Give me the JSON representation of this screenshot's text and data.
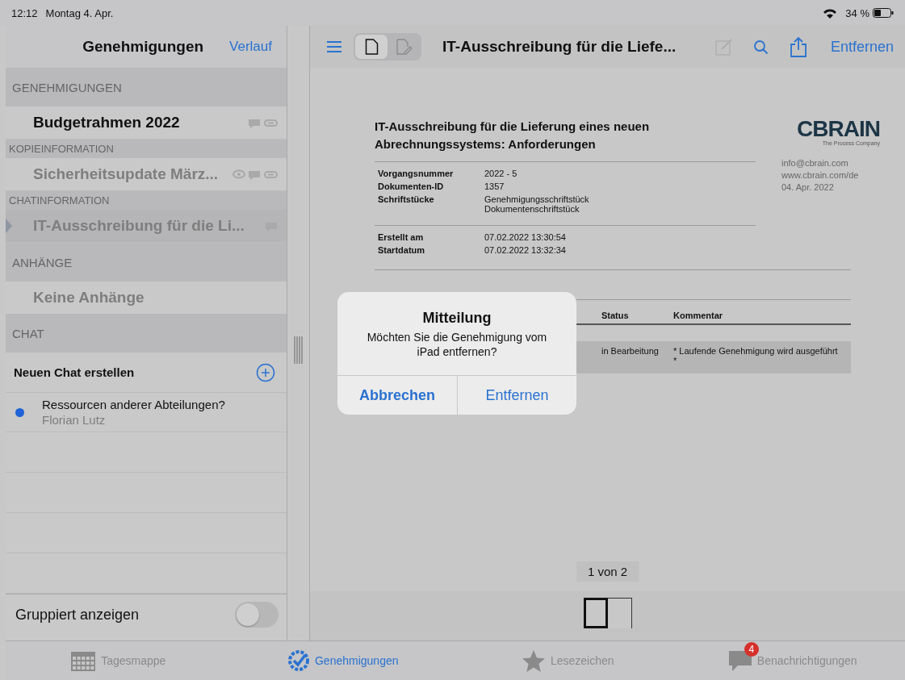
{
  "status_bar": {
    "time": "12:12",
    "date": "Montag 4. Apr.",
    "battery": "34 %"
  },
  "sidebar": {
    "title": "Genehmigungen",
    "history_link": "Verlauf",
    "sections": [
      {
        "header": "GENEHMIGUNGEN",
        "kind": "section",
        "items": [
          {
            "title": "Budgetrahmen 2022",
            "dimmed": false,
            "selected": false,
            "viewed": false,
            "comments": true,
            "attachments": true
          }
        ]
      },
      {
        "header": "KOPIEINFORMATION",
        "kind": "subsection",
        "items": [
          {
            "title": "Sicherheitsupdate März...",
            "dimmed": true,
            "selected": false,
            "viewed": true,
            "comments": true,
            "attachments": true
          }
        ]
      },
      {
        "header": "CHATINFORMATION",
        "kind": "subsection",
        "items": [
          {
            "title": "IT-Ausschreibung für die Li...",
            "dimmed": true,
            "selected": true,
            "viewed": false,
            "comments": true,
            "attachments": false
          }
        ]
      }
    ],
    "attachments": {
      "header": "ANHÄNGE",
      "empty_text": "Keine Anhänge"
    },
    "chat": {
      "header": "CHAT",
      "new_chat": "Neuen Chat erstellen",
      "threads": [
        {
          "title": "Ressourcen anderer Abteilungen?",
          "author": "Florian Lutz",
          "unread": true
        }
      ]
    },
    "grouping": {
      "label": "Gruppiert anzeigen",
      "on": false
    }
  },
  "toolbar": {
    "view_modes": [
      {
        "kind": "document",
        "selected": true
      },
      {
        "kind": "edit",
        "selected": false
      }
    ],
    "title": "IT-Ausschreibung für die Liefe...",
    "edit_disabled": true,
    "remove_button": "Entfernen"
  },
  "document": {
    "title": "IT-Ausschreibung für die Lieferung eines neuen Abrechnungssystems: Anforderungen",
    "logo": {
      "name": "CBRAIN",
      "tagline": "The Process Company"
    },
    "contact": [
      "info@cbrain.com",
      "www.cbrain.com/de",
      "04. Apr. 2022"
    ],
    "fields": [
      {
        "label": "Vorgangsnummer",
        "value": "2022 - 5"
      },
      {
        "label": "Dokumenten-ID",
        "value": "1357"
      },
      {
        "label": "Schriftstücke",
        "value": "Genehmigungsschriftstück\nDokumentenschriftstück"
      }
    ],
    "dates": [
      {
        "label": "Erstellt am",
        "value": "07.02.2022 13:30:54"
      },
      {
        "label": "Startdatum",
        "value": "07.02.2022 13:32:34"
      }
    ],
    "table": {
      "columns": [
        "Status",
        "Kommentar"
      ],
      "rows": [
        {
          "status": "in Bearbeitung",
          "comment": "* Laufende Genehmigung wird ausgeführt\n*"
        }
      ]
    },
    "page_indicator": "1 von 2",
    "thumbnails": [
      {
        "selected": true
      },
      {
        "selected": false
      }
    ]
  },
  "dialog": {
    "title": "Mitteilung",
    "message": "Möchten Sie die Genehmigung vom iPad entfernen?",
    "buttons": [
      {
        "label": "Abbrechen",
        "kind": "cancel"
      },
      {
        "label": "Entfernen",
        "kind": "default"
      }
    ]
  },
  "tab_bar": [
    {
      "label": "Tagesmappe",
      "kind": "calendar",
      "selected": false
    },
    {
      "label": "Genehmigungen",
      "kind": "approval",
      "selected": true
    },
    {
      "label": "Lesezeichen",
      "kind": "star",
      "selected": false
    },
    {
      "label": "Benachrichtigungen",
      "kind": "chat",
      "selected": false,
      "badge": "4"
    }
  ]
}
